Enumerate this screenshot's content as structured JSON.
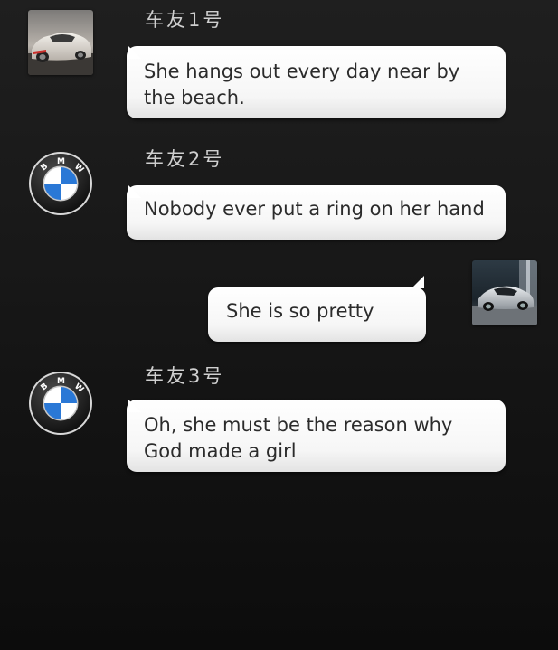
{
  "messages": [
    {
      "sender": "车友1号",
      "text": "She hangs out every day near by the beach.",
      "side": "left",
      "avatar": "sports-car-photo-icon"
    },
    {
      "sender": "车友2号",
      "text": "Nobody ever put a ring on her hand",
      "side": "left",
      "avatar": "bmw-logo-icon"
    },
    {
      "sender": "",
      "text": "She is so pretty",
      "side": "right",
      "avatar": "silver-car-photo-icon"
    },
    {
      "sender": "车友3号",
      "text": "Oh, she must be the reason why God made a girl",
      "side": "left",
      "avatar": "bmw-logo-icon"
    }
  ],
  "colors": {
    "background": "#1a1a1a",
    "bubble": "#ffffff",
    "sender_text": "#cfcfcf",
    "message_text": "#2b2b2b",
    "bmw_blue": "#1c69d4"
  }
}
